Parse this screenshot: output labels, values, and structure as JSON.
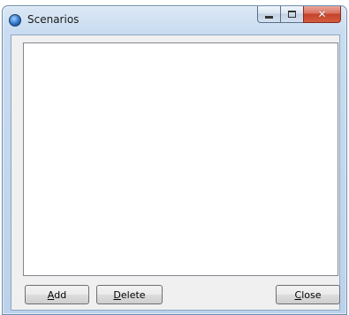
{
  "window": {
    "title": "Scenarios",
    "close_glyph": "✕",
    "icons": {
      "app": "app-globe-icon",
      "minimize": "minimize-icon",
      "maximize": "maximize-icon",
      "close": "close-icon"
    }
  },
  "list": {
    "items": []
  },
  "buttons": {
    "add": {
      "mnemonic": "A",
      "rest": "dd"
    },
    "delete": {
      "mnemonic": "D",
      "rest": "elete"
    },
    "close": {
      "mnemonic": "C",
      "rest": "lose"
    }
  },
  "colors": {
    "close_button": "#c4432a",
    "frame": "#bcd2ea"
  }
}
